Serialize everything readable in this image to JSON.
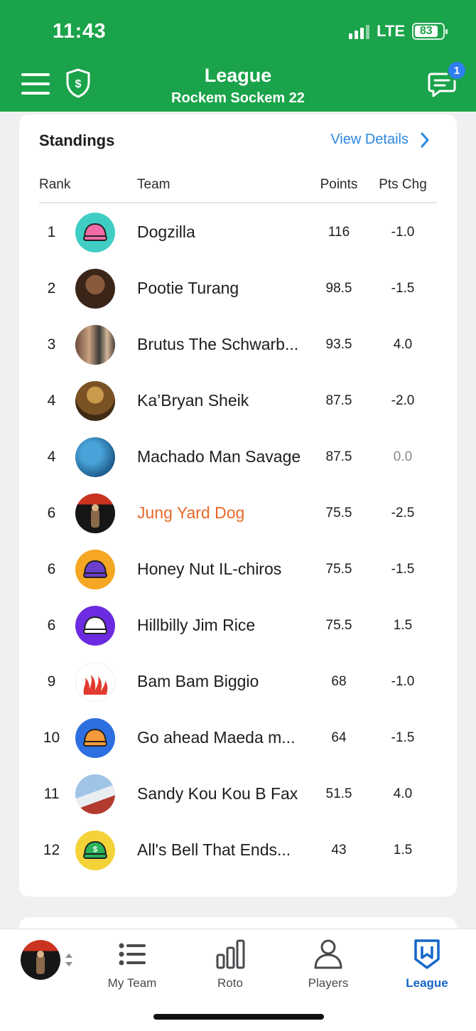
{
  "status": {
    "time": "11:43",
    "network": "LTE",
    "battery": "83"
  },
  "header": {
    "title": "League",
    "subtitle": "Rockem Sockem 22",
    "notification_count": "1"
  },
  "standings": {
    "title": "Standings",
    "view_details": "View Details",
    "columns": {
      "rank": "Rank",
      "team": "Team",
      "points": "Points",
      "pts_chg": "Pts Chg"
    },
    "rows": [
      {
        "rank": "1",
        "team": "Dogzilla",
        "points": "116",
        "pts_chg": "-1.0"
      },
      {
        "rank": "2",
        "team": "Pootie Turang",
        "points": "98.5",
        "pts_chg": "-1.5"
      },
      {
        "rank": "3",
        "team": "Brutus The Schwarb...",
        "points": "93.5",
        "pts_chg": "4.0"
      },
      {
        "rank": "4",
        "team": "Ka’Bryan Sheik",
        "points": "87.5",
        "pts_chg": "-2.0"
      },
      {
        "rank": "4",
        "team": "Machado Man Savage",
        "points": "87.5",
        "pts_chg": "0.0"
      },
      {
        "rank": "6",
        "team": "Jung Yard Dog",
        "points": "75.5",
        "pts_chg": "-2.5"
      },
      {
        "rank": "6",
        "team": "Honey Nut IL-chiros",
        "points": "75.5",
        "pts_chg": "-1.5"
      },
      {
        "rank": "6",
        "team": "Hillbilly Jim Rice",
        "points": "75.5",
        "pts_chg": "1.5"
      },
      {
        "rank": "9",
        "team": "Bam Bam Biggio",
        "points": "68",
        "pts_chg": "-1.0"
      },
      {
        "rank": "10",
        "team": "Go ahead Maeda m...",
        "points": "64",
        "pts_chg": "-1.5"
      },
      {
        "rank": "11",
        "team": "Sandy Kou Kou B Fax",
        "points": "51.5",
        "pts_chg": "4.0"
      },
      {
        "rank": "12",
        "team": "All's Bell That Ends...",
        "points": "43",
        "pts_chg": "1.5"
      }
    ]
  },
  "tabs": {
    "my_team": "My Team",
    "roto": "Roto",
    "players": "Players",
    "league": "League"
  },
  "colors": {
    "brand_green": "#1aa34a",
    "link_blue": "#2c87e0",
    "my_team_orange": "#e8692a",
    "active_tab": "#1565c8"
  }
}
